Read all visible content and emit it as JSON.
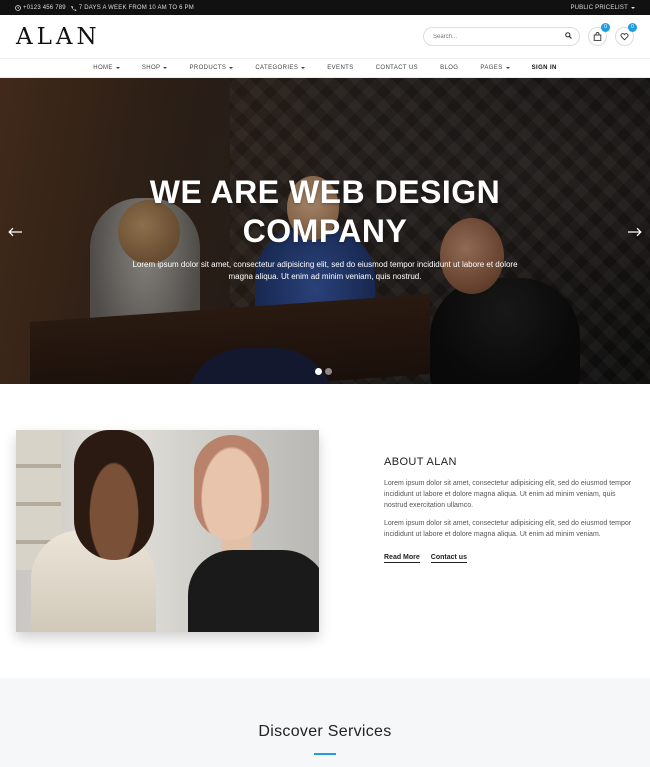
{
  "topbar": {
    "phone": "+0123 456 789",
    "hours": "7 DAYS A WEEK FROM 10 AM TO 6 PM",
    "pricelist": "PUBLIC PRICELIST"
  },
  "header": {
    "logo": "ALAN",
    "search_placeholder": "Search...",
    "cart_count": "0",
    "wishlist_count": "0"
  },
  "nav": {
    "items": [
      {
        "label": "HOME",
        "dropdown": true
      },
      {
        "label": "SHOP",
        "dropdown": true
      },
      {
        "label": "PRODUCTS",
        "dropdown": true
      },
      {
        "label": "CATEGORIES",
        "dropdown": true
      },
      {
        "label": "EVENTS",
        "dropdown": false
      },
      {
        "label": "CONTACT US",
        "dropdown": false
      },
      {
        "label": "BLOG",
        "dropdown": false
      },
      {
        "label": "PAGES",
        "dropdown": true
      },
      {
        "label": "SIGN IN",
        "dropdown": false
      }
    ]
  },
  "hero": {
    "title_line1": "WE ARE WEB DESIGN",
    "title_line2": "COMPANY",
    "text": "Lorem ipsum dolor sit amet, consectetur adipisicing elit, sed do eiusmod tempor incididunt ut labore et dolore magna aliqua. Ut enim ad minim veniam, quis nostrud.",
    "prev_icon": "arrow-left-icon",
    "next_icon": "arrow-right-icon",
    "slides": 2,
    "active_slide": 1
  },
  "about": {
    "title": "ABOUT ALAN",
    "para1": "Lorem ipsum dolor sit amet, consectetur adipisicing elit, sed do eiusmod tempor incididunt ut labore et dolore magna aliqua. Ut enim ad minim veniam, quis nostrud exercitation ullamco.",
    "para2": "Lorem ipsum dolor sit amet, consectetur adipisicing elit, sed do eiusmod tempor incididunt ut labore et dolore magna aliqua. Ut enim ad minim veniam.",
    "read_more": "Read More",
    "contact_us": "Contact us"
  },
  "services": {
    "title": "Discover Services"
  },
  "colors": {
    "accent": "#1e9ee0",
    "topbar": "#111111"
  }
}
